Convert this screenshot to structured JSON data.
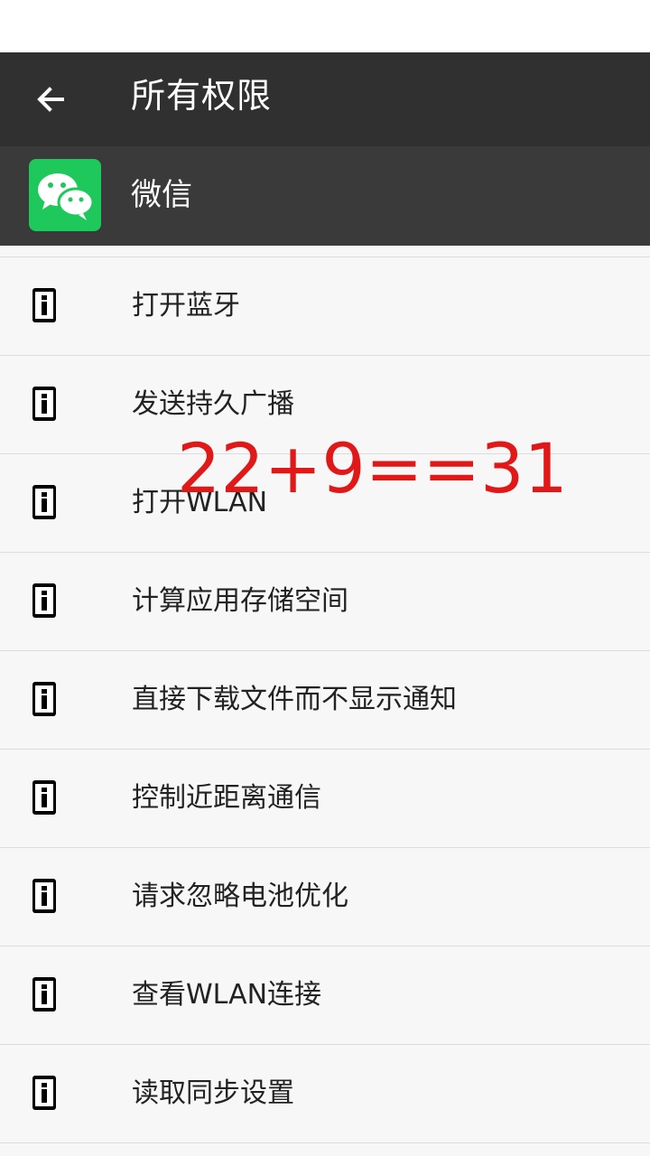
{
  "toolbar": {
    "title": "所有权限",
    "back_icon": "arrow-back-icon"
  },
  "app": {
    "name": "微信",
    "icon": "wechat-logo-icon",
    "icon_color": "#1ec85a"
  },
  "permissions": [
    {
      "label": "打开蓝牙",
      "icon": "info-icon"
    },
    {
      "label": "发送持久广播",
      "icon": "info-icon"
    },
    {
      "label": "打开WLAN",
      "icon": "info-icon"
    },
    {
      "label": "计算应用存储空间",
      "icon": "info-icon"
    },
    {
      "label": "直接下载文件而不显示通知",
      "icon": "info-icon"
    },
    {
      "label": "控制近距离通信",
      "icon": "info-icon"
    },
    {
      "label": "请求忽略电池优化",
      "icon": "info-icon"
    },
    {
      "label": "查看WLAN连接",
      "icon": "info-icon"
    },
    {
      "label": "读取同步设置",
      "icon": "info-icon"
    }
  ],
  "overlay": {
    "text": "22+9==31",
    "color": "#e01818"
  },
  "colors": {
    "toolbar_bg": "#303030",
    "app_header_bg": "#3a3a3a",
    "list_bg": "#f7f7f7",
    "divider": "#dcdcdc"
  }
}
